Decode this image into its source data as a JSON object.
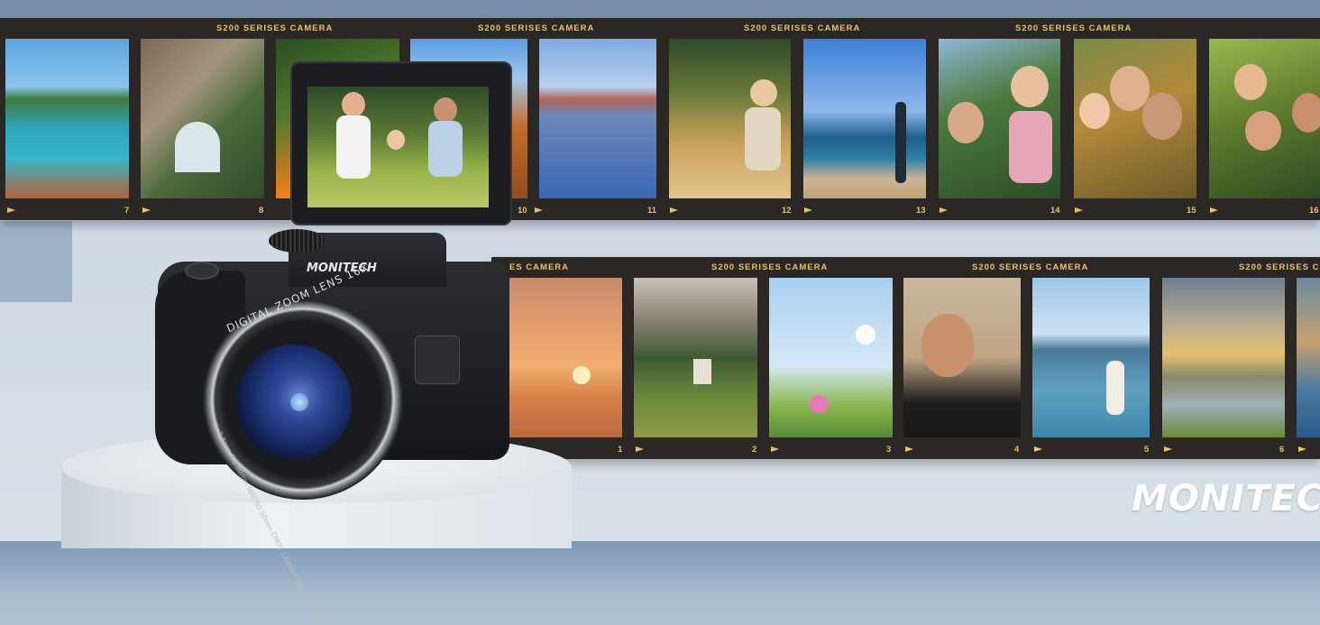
{
  "strips": {
    "top_title": "S200 SERISES CAMERA",
    "bottom_title": "S200 SERISES CAMERA",
    "bottom_title_partial": "ES CAMERA",
    "top_numbers": [
      "7",
      "8",
      "10",
      "11",
      "12",
      "13",
      "14",
      "15",
      "16"
    ],
    "bottom_numbers": [
      "1",
      "2",
      "3",
      "4",
      "5",
      "6"
    ]
  },
  "camera": {
    "brand": "MONITECH",
    "lens_label": "DIGITAL ZOOM LENS 16X",
    "lens_specs": "F=3.8mm F/8.00mm MACRO 50mm CMOS CAMERA DIGITAL ZOOM"
  },
  "logo": {
    "text": "MONITECH"
  },
  "colors": {
    "film": "#2a2725",
    "film_text": "#e7c26a",
    "background": "#cfd9e3"
  }
}
